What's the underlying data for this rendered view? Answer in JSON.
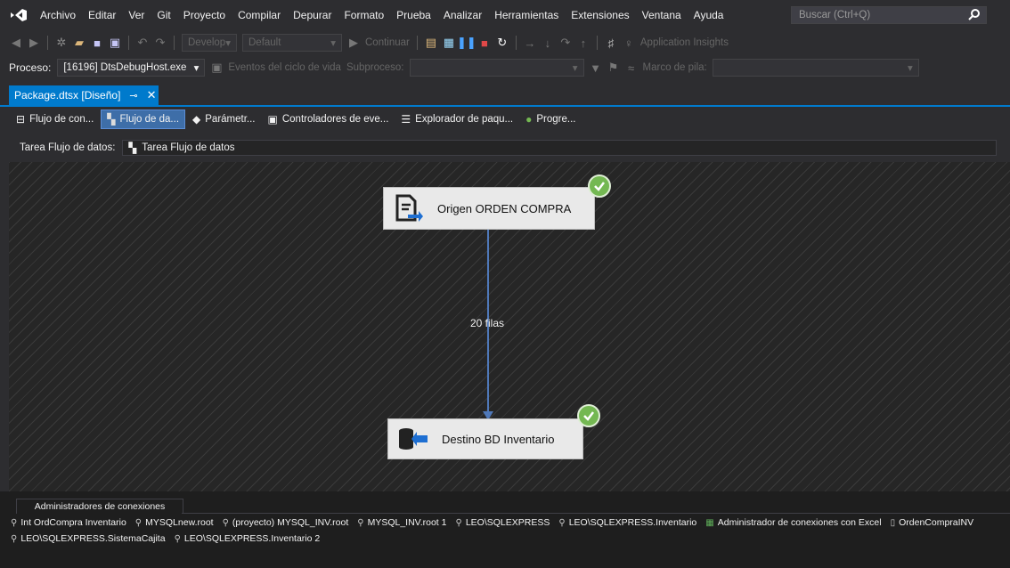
{
  "menu": {
    "items": [
      "Archivo",
      "Editar",
      "Ver",
      "Git",
      "Proyecto",
      "Compilar",
      "Depurar",
      "Formato",
      "Prueba",
      "Analizar",
      "Herramientas",
      "Extensiones",
      "Ventana",
      "Ayuda"
    ],
    "search_placeholder": "Buscar (Ctrl+Q)"
  },
  "toolbar": {
    "config_label": "Develop",
    "platform_label": "Default",
    "continue_label": "Continuar",
    "insights_label": "Application Insights"
  },
  "debugbar": {
    "process_label": "Proceso:",
    "process_value": "[16196] DtsDebugHost.exe",
    "lifecycle_label": "Eventos del ciclo de vida",
    "thread_label": "Subproceso:",
    "stack_label": "Marco de pila:"
  },
  "document_tab": {
    "title": "Package.dtsx [Diseño]"
  },
  "designer_tabs": [
    {
      "label": "Flujo de con...",
      "icon": "control-flow-icon",
      "active": false
    },
    {
      "label": "Flujo de da...",
      "icon": "data-flow-icon",
      "active": true
    },
    {
      "label": "Parámetr...",
      "icon": "parameters-icon",
      "active": false
    },
    {
      "label": "Controladores de eve...",
      "icon": "event-handlers-icon",
      "active": false
    },
    {
      "label": "Explorador de paqu...",
      "icon": "package-explorer-icon",
      "active": false
    },
    {
      "label": "Progre...",
      "icon": "progress-icon",
      "active": false
    }
  ],
  "task_row": {
    "label": "Tarea Flujo de datos:",
    "value": "Tarea Flujo de datos"
  },
  "canvas": {
    "source": {
      "label": "Origen ORDEN COMPRA",
      "status": "success"
    },
    "destination": {
      "label": "Destino BD Inventario",
      "status": "success"
    },
    "path_label": "20 filas"
  },
  "connections": {
    "tab_label": "Administradores de conexiones",
    "items": [
      "Int OrdCompra Inventario",
      "MYSQLnew.root",
      "(proyecto) MYSQL_INV.root",
      "MYSQL_INV.root 1",
      "LEO\\SQLEXPRESS",
      "LEO\\SQLEXPRESS.Inventario",
      "Administrador de conexiones con Excel",
      "OrdenCompraINV",
      "LEO\\SQLEXPRESS.SistemaCajita",
      "LEO\\SQLEXPRESS.Inventario 2"
    ]
  },
  "colors": {
    "accent": "#007acc",
    "success": "#74b852",
    "background": "#2d2d30",
    "canvas": "#262626"
  }
}
